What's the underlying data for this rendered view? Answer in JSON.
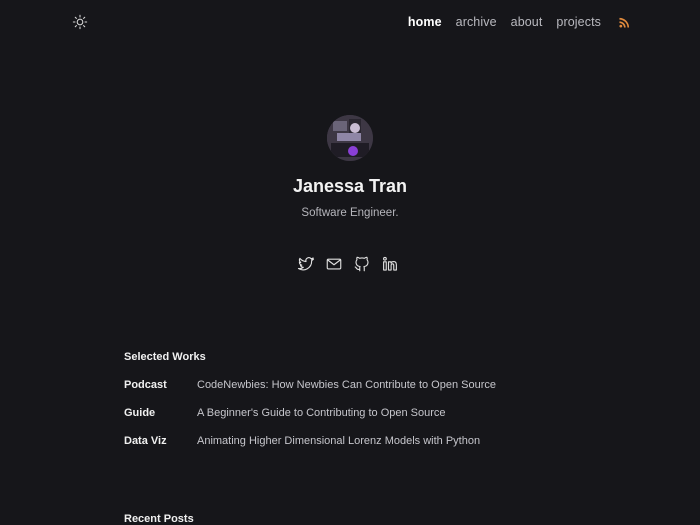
{
  "header": {
    "theme_icon": "sun-icon",
    "nav": [
      {
        "label": "home",
        "active": true
      },
      {
        "label": "archive",
        "active": false
      },
      {
        "label": "about",
        "active": false
      },
      {
        "label": "projects",
        "active": false
      }
    ],
    "rss_icon": "rss-icon",
    "rss_color": "#e08a3c"
  },
  "profile": {
    "name": "Janessa Tran",
    "tagline": "Software Engineer.",
    "socials": [
      "twitter-icon",
      "mail-icon",
      "github-icon",
      "linkedin-icon"
    ]
  },
  "works": {
    "title": "Selected Works",
    "items": [
      {
        "category": "Podcast",
        "title": "CodeNewbies: How Newbies Can Contribute to Open Source"
      },
      {
        "category": "Guide",
        "title": "A Beginner's Guide to Contributing to Open Source"
      },
      {
        "category": "Data Viz",
        "title": "Animating Higher Dimensional Lorenz Models with Python"
      }
    ]
  },
  "posts": {
    "title": "Recent Posts"
  }
}
